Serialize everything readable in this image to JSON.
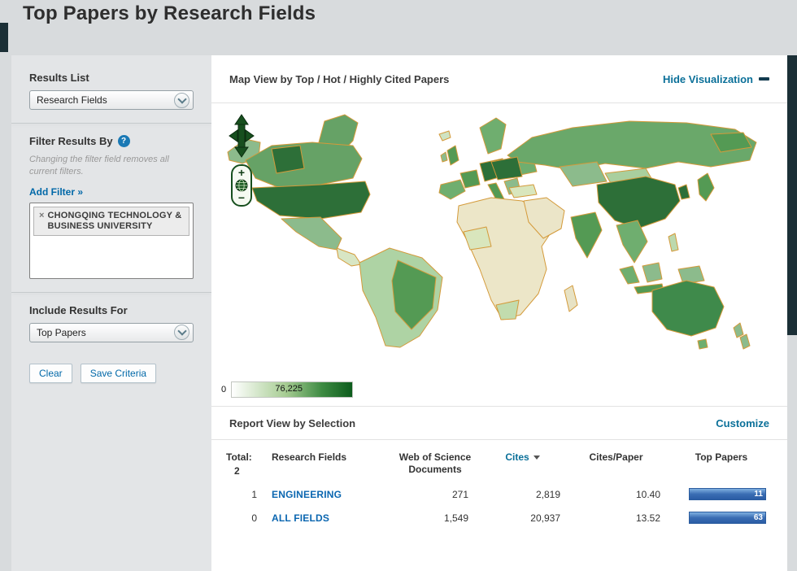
{
  "page": {
    "title": "Top Papers by Research Fields"
  },
  "sidebar": {
    "results_list_label": "Results List",
    "results_list_value": "Research Fields",
    "filter_label": "Filter Results By",
    "help_glyph": "?",
    "filter_note": "Changing the filter field removes all current filters.",
    "add_filter": "Add Filter »",
    "filter_chip": {
      "remove": "×",
      "label": "CHONGQING TECHNOLOGY & BUSINESS UNIVERSITY"
    },
    "include_label": "Include Results For",
    "include_value": "Top Papers",
    "clear_button": "Clear",
    "save_button": "Save Criteria"
  },
  "map": {
    "title": "Map View by Top / Hot / Highly Cited Papers",
    "hide_link": "Hide Visualization",
    "zoom_in": "+",
    "zoom_out": "−",
    "legend_min": "0",
    "legend_max": "76,225"
  },
  "report": {
    "title": "Report View by Selection",
    "customize": "Customize",
    "total_label": "Total:",
    "total_value": "2",
    "col_field": "Research Fields",
    "col_documents": "Web of Science Documents",
    "col_cites": "Cites",
    "col_cites_per_paper": "Cites/Paper",
    "col_top_papers": "Top Papers",
    "rows": [
      {
        "rank": "1",
        "field": "ENGINEERING",
        "documents": "271",
        "cites": "2,819",
        "cites_per_paper": "10.40",
        "top_papers": "11"
      },
      {
        "rank": "0",
        "field": "ALL FIELDS",
        "documents": "1,549",
        "cites": "20,937",
        "cites_per_paper": "13.52",
        "top_papers": "63"
      }
    ]
  },
  "colors": {
    "link_teal": "#0b7099",
    "link_blue": "#0a66b0",
    "bar_blue": "#2a5ca5",
    "map_dark_green": "#2d6f38",
    "map_border_orange": "#d49a3a",
    "legend_max_green": "#0d5c1d"
  }
}
